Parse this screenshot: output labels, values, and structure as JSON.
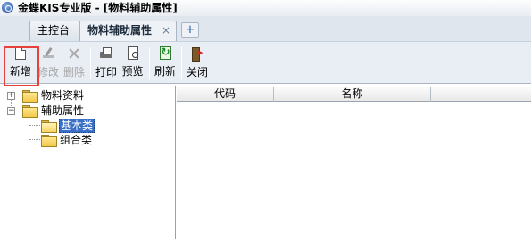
{
  "titlebar": {
    "title": "金蝶KIS专业版 - [物料辅助属性]",
    "icon": "kingdee-logo-icon"
  },
  "tabs": {
    "items": [
      {
        "label": "主控台",
        "active": false
      },
      {
        "label": "物料辅助属性",
        "active": true,
        "close_glyph": "×"
      }
    ],
    "add_glyph": "+"
  },
  "toolbar": {
    "buttons": [
      {
        "label": "新增",
        "icon": "new-document-icon",
        "enabled": true
      },
      {
        "label": "修改",
        "icon": "edit-icon",
        "enabled": false
      },
      {
        "label": "删除",
        "icon": "delete-icon",
        "enabled": false
      },
      {
        "label": "打印",
        "icon": "printer-icon",
        "enabled": true
      },
      {
        "label": "预览",
        "icon": "preview-icon",
        "enabled": true
      },
      {
        "label": "刷新",
        "icon": "refresh-icon",
        "enabled": true
      },
      {
        "label": "关闭",
        "icon": "exit-icon",
        "enabled": true
      }
    ],
    "highlight_color": "#e8403a"
  },
  "tree": {
    "nodes": [
      {
        "label": "物料资料",
        "expander": "+",
        "expanded": false
      },
      {
        "label": "辅助属性",
        "expander": "−",
        "expanded": true,
        "children": [
          {
            "label": "基本类",
            "selected": true
          },
          {
            "label": "组合类",
            "selected": false
          }
        ]
      }
    ]
  },
  "grid": {
    "columns": [
      "代码",
      "名称"
    ],
    "rows": []
  },
  "colors": {
    "selection": "#3a6fc8",
    "toolbar_bg": "#e9eef4",
    "folder": "#f2c94a"
  }
}
